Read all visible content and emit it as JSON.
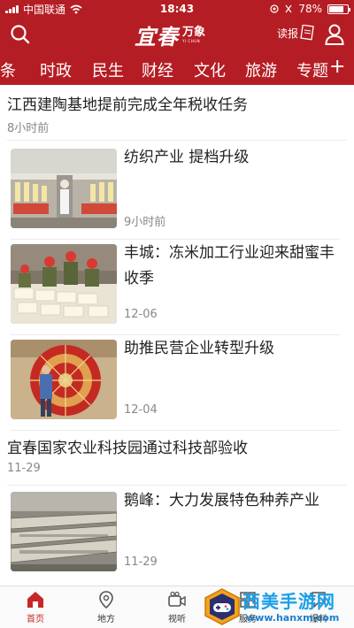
{
  "status_bar": {
    "carrier": "中国联通",
    "time": "18:43",
    "battery_percent": "78%",
    "battery_level": 0.78
  },
  "header": {
    "logo_main": "宜春",
    "logo_sub": "万象",
    "paper_label": "读报"
  },
  "tabs": [
    "头条",
    "时政",
    "民生",
    "财经",
    "文化",
    "旅游",
    "专题"
  ],
  "tab_plus": "+",
  "feed": {
    "items": [
      {
        "type": "text",
        "title": "江西建陶基地提前完成全年税收任务",
        "date": "8小时前"
      },
      {
        "type": "card",
        "title": "纺织产业 提档升级",
        "date": "9小时前",
        "image": "textile-factory"
      },
      {
        "type": "card",
        "title": "丰城：冻米加工行业迎来甜蜜丰收季",
        "date": "12-06",
        "image": "rice-workers"
      },
      {
        "type": "card",
        "title": "助推民营企业转型升级",
        "date": "12-04",
        "image": "red-machine-worker"
      },
      {
        "type": "text",
        "title": "宜春国家农业科技园通过科技部验收",
        "date": "11-29"
      },
      {
        "type": "card",
        "title": "鹅峰：大力发展特色种养产业",
        "date": "11-29",
        "image": "silkworm-trays"
      }
    ]
  },
  "bottom_nav": [
    {
      "label": "首页",
      "icon": "home-icon",
      "active": true
    },
    {
      "label": "地方",
      "icon": "location-pin-icon",
      "active": false
    },
    {
      "label": "视听",
      "icon": "video-camera-icon",
      "active": false
    },
    {
      "label": "服务",
      "icon": "service-icon",
      "active": false
    },
    {
      "label": "爆料",
      "icon": "report-icon",
      "active": false
    }
  ],
  "watermark": {
    "title": "西美手游网",
    "url": "www.hanxm.com"
  },
  "colors": {
    "brand_red": "#b51d24",
    "active_nav": "#c62828",
    "date_gray": "#888888",
    "watermark_blue": "#1aa0e8"
  }
}
